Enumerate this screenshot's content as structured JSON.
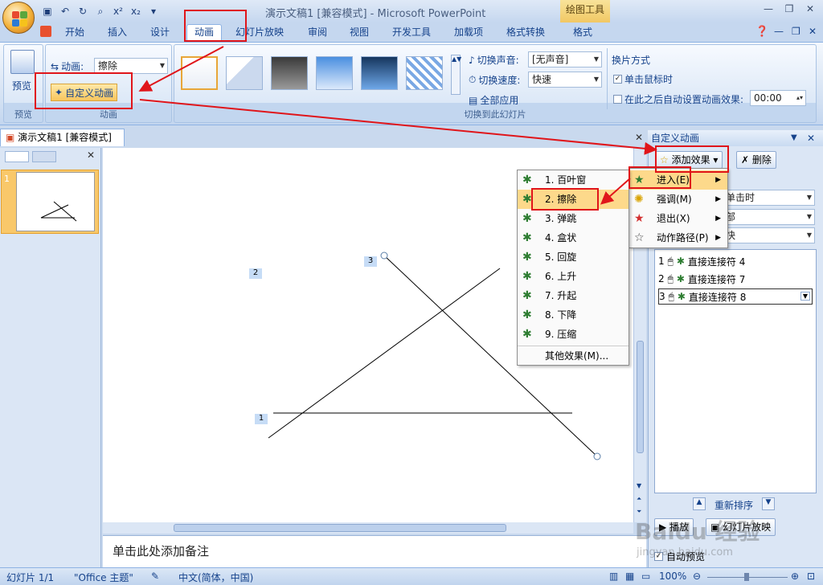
{
  "window": {
    "title": "演示文稿1 [兼容模式] - Microsoft PowerPoint",
    "context_tool": "绘图工具"
  },
  "tabs": [
    "开始",
    "插入",
    "设计",
    "动画",
    "幻灯片放映",
    "审阅",
    "视图",
    "开发工具",
    "加载项",
    "格式转换",
    "格式"
  ],
  "ribbon": {
    "preview_label": "预览",
    "preview_group": "预览",
    "anim_label": "动画:",
    "anim_value": "擦除",
    "custom_anim": "自定义动画",
    "anim_group": "动画",
    "sound_label": "切换声音:",
    "sound_value": "[无声音]",
    "speed_label": "切换速度:",
    "speed_value": "快速",
    "apply_all": "全部应用",
    "transition_group": "切换到此幻灯片",
    "advance_title": "换片方式",
    "on_click": "单击鼠标时",
    "auto_after": "在此之后自动设置动画效果:",
    "auto_time": "00:00"
  },
  "doc_tab": "演示文稿1 [兼容模式]",
  "slide_number": "1",
  "canvas_markers": [
    "1",
    "2",
    "3"
  ],
  "notes_placeholder": "单击此处添加备注",
  "taskpane": {
    "title": "自定义动画",
    "add_effect": "添加效果",
    "delete": "删除",
    "combo1": "单击时",
    "combo2": "部",
    "combo3": "快",
    "items": [
      {
        "num": "1",
        "name": "直接连接符 4"
      },
      {
        "num": "2",
        "name": "直接连接符 7"
      },
      {
        "num": "3",
        "name": "直接连接符 8"
      }
    ],
    "reorder": "重新排序",
    "play": "播放",
    "slideshow": "幻灯片放映",
    "autopreview": "自动预览"
  },
  "menu_effects": {
    "items": [
      {
        "label": "进入(E)"
      },
      {
        "label": "强调(M)"
      },
      {
        "label": "退出(X)"
      },
      {
        "label": "动作路径(P)"
      }
    ]
  },
  "menu_entrance": {
    "items": [
      "1. 百叶窗",
      "2. 擦除",
      "3. 弹跳",
      "4. 盒状",
      "5. 回旋",
      "6. 上升",
      "7. 升起",
      "8. 下降",
      "9. 压缩"
    ],
    "more": "其他效果(M)..."
  },
  "status": {
    "slide": "幻灯片 1/1",
    "theme": "\"Office 主题\"",
    "lang": "中文(简体，中国)",
    "zoom": "100%"
  },
  "watermark": "Baidu 经验",
  "watermark_url": "jingyan.baidu.com"
}
